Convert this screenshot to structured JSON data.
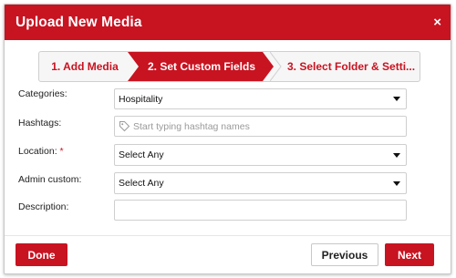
{
  "modal": {
    "title": "Upload New Media",
    "close_symbol": "×"
  },
  "steps": [
    {
      "label": "1. Add Media"
    },
    {
      "label": "2. Set Custom Fields"
    },
    {
      "label": "3. Select Folder & Setti..."
    }
  ],
  "form": {
    "categories": {
      "label": "Categories:",
      "value": "Hospitality"
    },
    "hashtags": {
      "label": "Hashtags:",
      "placeholder": "Start typing hashtag names",
      "icon": "tag-icon"
    },
    "location": {
      "label": "Location:",
      "required_marker": "*",
      "value": "Select Any"
    },
    "admin_custom": {
      "label": "Admin custom:",
      "value": "Select Any"
    },
    "description": {
      "label": "Description:",
      "value": ""
    }
  },
  "footer": {
    "done_label": "Done",
    "previous_label": "Previous",
    "next_label": "Next"
  },
  "colors": {
    "accent": "#c81321"
  }
}
